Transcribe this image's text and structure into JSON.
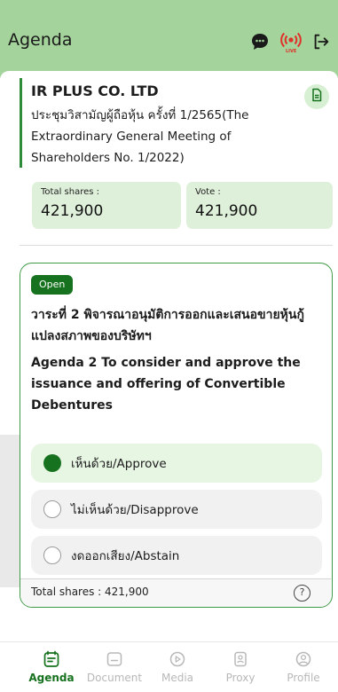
{
  "header": {
    "title": "Agenda",
    "icons": [
      "chat-bubble-icon",
      "live-broadcast-icon",
      "logout-icon"
    ],
    "live_badge": "LIVE",
    "background_color": "#a4d39b"
  },
  "company": {
    "name": "IR PLUS CO. LTD",
    "meeting_title": "ประชุมวิสามัญผู้ถือหุ้น ครั้งที่ 1/2565(The Extraordinary General Meeting of Shareholders No. 1/2022)",
    "document_icon": "document-icon"
  },
  "stats": {
    "total_shares_label": "Total shares :",
    "total_shares_value": "421,900",
    "vote_label": "Vote :",
    "vote_value": "421,900"
  },
  "agenda": {
    "status": "Open",
    "title_th": "วาระที่ 2 พิจารณาอนุมัติการออกและเสนอขายหุ้นกู้แปลงสภาพของบริษัทฯ",
    "title_en": "Agenda 2 To consider and approve the issuance and offering of Convertible Debentures",
    "options": [
      {
        "label": "เห็นด้วย/Approve",
        "selected": true
      },
      {
        "label": "ไม่เห็นด้วย/Disapprove",
        "selected": false
      },
      {
        "label": "งดออกเสียง/Abstain",
        "selected": false
      }
    ],
    "footer_total": "Total shares : 421,900",
    "help_icon": "?"
  },
  "nav": {
    "items": [
      {
        "label": "Agenda",
        "icon": "agenda-icon",
        "active": true
      },
      {
        "label": "Document",
        "icon": "document-icon",
        "active": false
      },
      {
        "label": "Media",
        "icon": "play-icon",
        "active": false
      },
      {
        "label": "Proxy",
        "icon": "proxy-icon",
        "active": false
      },
      {
        "label": "Profile",
        "icon": "profile-icon",
        "active": false
      }
    ]
  },
  "colors": {
    "accent": "#17721f",
    "live": "#e0302a"
  }
}
